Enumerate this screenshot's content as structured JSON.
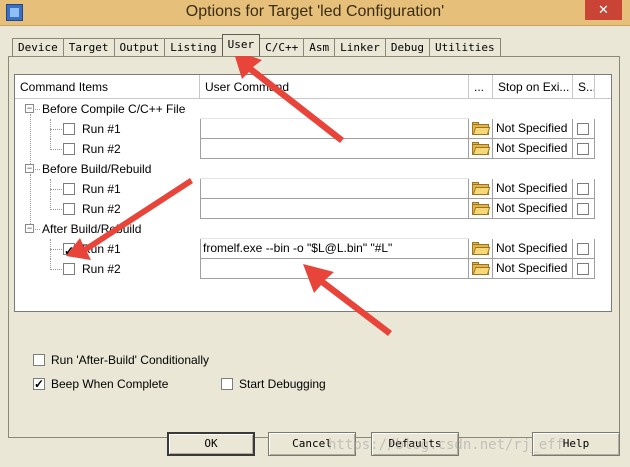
{
  "window": {
    "title": "Options for Target 'led Configuration'",
    "close_glyph": "✕"
  },
  "tabs": [
    {
      "label": "Device",
      "active": false
    },
    {
      "label": "Target",
      "active": false
    },
    {
      "label": "Output",
      "active": false
    },
    {
      "label": "Listing",
      "active": false
    },
    {
      "label": "User",
      "active": true
    },
    {
      "label": "C/C++",
      "active": false
    },
    {
      "label": "Asm",
      "active": false
    },
    {
      "label": "Linker",
      "active": false
    },
    {
      "label": "Debug",
      "active": false
    },
    {
      "label": "Utilities",
      "active": false
    }
  ],
  "grid": {
    "headers": {
      "command_items": "Command Items",
      "user_command": "User Command",
      "browse": "...",
      "stop_on_exit": "Stop on Exi...",
      "s": "S..."
    },
    "groups": [
      {
        "label": "Before Compile C/C++ File",
        "expander": "−",
        "runs": [
          {
            "label": "Run #1",
            "checked": false,
            "command": "",
            "stop": "Not Specified",
            "s_checked": false
          },
          {
            "label": "Run #2",
            "checked": false,
            "command": "",
            "stop": "Not Specified",
            "s_checked": false
          }
        ]
      },
      {
        "label": "Before Build/Rebuild",
        "expander": "−",
        "runs": [
          {
            "label": "Run #1",
            "checked": false,
            "command": "",
            "stop": "Not Specified",
            "s_checked": false
          },
          {
            "label": "Run #2",
            "checked": false,
            "command": "",
            "stop": "Not Specified",
            "s_checked": false
          }
        ]
      },
      {
        "label": "After Build/Rebuild",
        "expander": "−",
        "runs": [
          {
            "label": "Run #1",
            "checked": true,
            "command": "fromelf.exe --bin -o \"$L@L.bin\" \"#L\"",
            "stop": "Not Specified",
            "s_checked": false
          },
          {
            "label": "Run #2",
            "checked": false,
            "command": "",
            "stop": "Not Specified",
            "s_checked": false
          }
        ]
      }
    ]
  },
  "options": {
    "run_after_build": {
      "label": "Run 'After-Build' Conditionally",
      "checked": false
    },
    "beep": {
      "label": "Beep When Complete",
      "checked": true
    },
    "start_debugging": {
      "label": "Start Debugging",
      "checked": false
    }
  },
  "buttons": {
    "ok": "OK",
    "cancel": "Cancel",
    "defaults": "Defaults",
    "help": "Help"
  },
  "watermark": "https://blog.csdn.net/rj_eff",
  "colors": {
    "titlebar": "#e6c07b",
    "dialog_bg": "#ebe7d6",
    "annotation_arrow": "#e8443a",
    "close_button": "#c94435"
  }
}
